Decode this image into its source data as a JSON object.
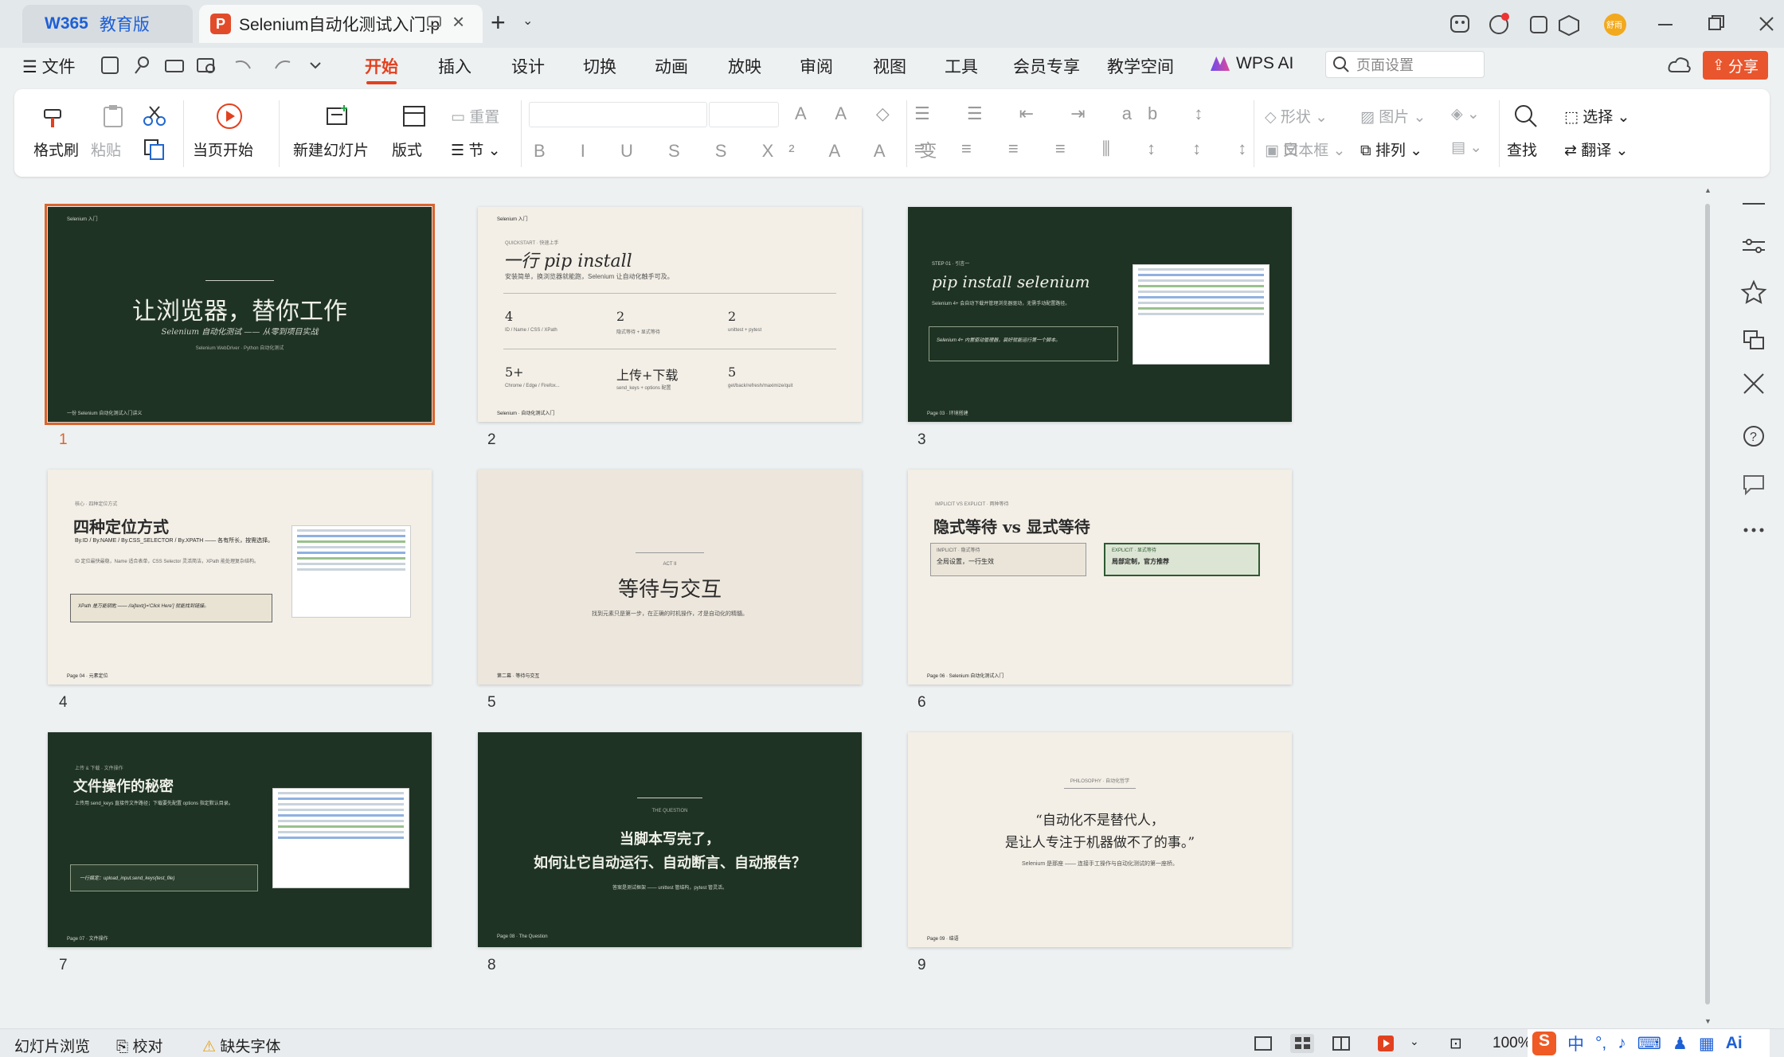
{
  "app": {
    "home_logo": "W365",
    "home_sub": "教育版",
    "doc_tab": "Selenium自动化测试入门.p",
    "user": "舒雨",
    "share": "分享",
    "icons": [
      "tab-close-icon",
      "new-tab-icon",
      "minimize-icon",
      "restore-icon",
      "close-window-icon"
    ]
  },
  "menu": {
    "file": "文件",
    "items": [
      "开始",
      "插入",
      "设计",
      "切换",
      "动画",
      "放映",
      "审阅",
      "视图",
      "工具",
      "会员专享",
      "教学空间"
    ],
    "ai": "WPS AI",
    "search_placeholder": "页面设置"
  },
  "ribbon": {
    "format_painter": "格式刷",
    "paste": "粘贴",
    "play_from_current": "当页开始",
    "new_slide": "新建幻灯片",
    "layout": "版式",
    "reset": "重置",
    "section": "节",
    "shape": "形状",
    "picture": "图片",
    "textbox": "文本框",
    "arrange": "排列",
    "find": "查找",
    "select": "选择",
    "translate": "翻译"
  },
  "slides": [
    {
      "num": "1",
      "top": "Selenium 入门",
      "title": "让浏览器，替你工作",
      "subtitle": "Selenium 自动化测试 —— 从零到项目实战",
      "note": "Selenium WebDriver · Python 自动化测试",
      "footer": "一份 Selenium 自动化测试入门讲义"
    },
    {
      "num": "2",
      "top": "Selenium 入门",
      "kicker": "QUICKSTART · 快速上手",
      "title": "一行 pip install",
      "desc": "安装简单，换浏览器就能跑，Selenium 让自动化触手可及。",
      "stats": [
        {
          "n": "4",
          "l": "ID / Name / CSS / XPath"
        },
        {
          "n": "2",
          "l": "隐式等待 + 显式等待"
        },
        {
          "n": "2",
          "l": "unittest + pytest"
        },
        {
          "n": "5+",
          "l": "Chrome / Edge / Firefox..."
        },
        {
          "n": "上传+下载",
          "l": "send_keys + options 配置"
        },
        {
          "n": "5",
          "l": "get/back/refresh/maximize/quit"
        }
      ],
      "footer": "Selenium · 自动化测试入门"
    },
    {
      "num": "3",
      "kicker": "STEP 01 · 引言一",
      "title": "pip install selenium",
      "desc": "Selenium 4+ 会自动下载并管理浏览器驱动，无需手动配置路径。",
      "quote": "Selenium 4+ 内置驱动管理器，装好就能运行第一个脚本。",
      "footer": "Page 03 · 环境搭建"
    },
    {
      "num": "4",
      "kicker": "核心 · 四种定位方式",
      "title": "四种定位方式",
      "desc": "By.ID / By.NAME / By.CSS_SELECTOR / By.XPATH —— 各有所长，按需选择。",
      "body": "ID 定位最快最稳，Name 适合表单，CSS Selector 灵活简洁，XPath 能处理复杂结构。",
      "quote": "XPath 是万能钥匙 —— //a[text()='Click Here'] 就能找到链接。",
      "footer": "Page 04 · 元素定位"
    },
    {
      "num": "5",
      "kicker": "ACT II",
      "title": "等待与交互",
      "desc": "找到元素只是第一步，在正确的时机操作，才是自动化的精髓。",
      "footer": "第二幕 · 等待与交互"
    },
    {
      "num": "6",
      "kicker": "IMPLICIT VS EXPLICIT · 两种等待",
      "title": "隐式等待 vs 显式等待",
      "left_title": "全局设置，一行生效",
      "left_tag": "IMPLICIT · 隐式等待",
      "right_title": "局部定制，官方推荐",
      "right_tag": "EXPLICIT · 显式等待",
      "footer": "Page 06 · Selenium 自动化测试入门"
    },
    {
      "num": "7",
      "kicker": "上传 & 下载 · 文件操作",
      "title": "文件操作的秘密",
      "desc": "上传用 send_keys 直接传文件路径；下载要先配置 options 指定默认目录。",
      "quote": "一行搞定：upload_input.send_keys(test_file)",
      "footer": "Page 07 · 文件操作"
    },
    {
      "num": "8",
      "kicker": "THE QUESTION",
      "title1": "当脚本写完了，",
      "title2": "如何让它自动运行、自动断言、自动报告？",
      "desc": "答案是测试框架 —— unittest 管结构，pytest 管灵活。",
      "footer": "Page 08 · The Question"
    },
    {
      "num": "9",
      "kicker": "PHILOSOPHY · 自动化哲学",
      "quote1": "“自动化不是替代人，",
      "quote2": "是让人专注于机器做不了的事。”",
      "desc": "Selenium 是那座 —— 连接手工操作与自动化测试的第一座桥。",
      "footer": "Page 09 · 结语"
    }
  ],
  "status": {
    "view": "幻灯片浏览",
    "proof": "校对",
    "missing_font": "缺失字体",
    "zoom": "100%"
  },
  "colors": {
    "accent": "#e2411f",
    "selection": "#d9652d",
    "dark_slide": "#1f3324",
    "light_slide": "#f3efe6"
  }
}
